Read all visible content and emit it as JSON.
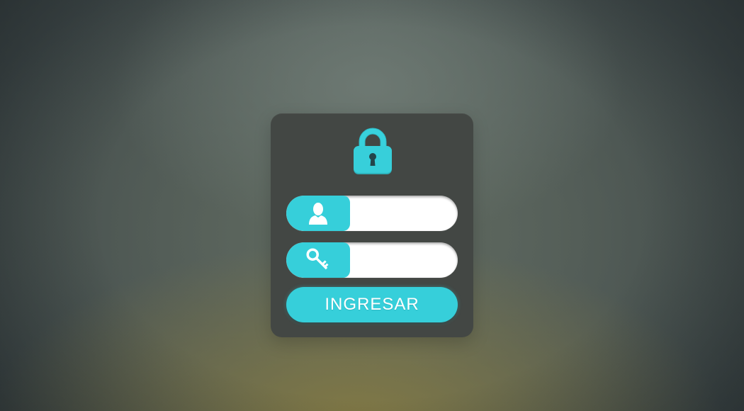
{
  "login": {
    "submit_label": "INGRESAR",
    "username": {
      "value": "",
      "placeholder": "",
      "icon": "user-icon"
    },
    "password": {
      "value": "",
      "placeholder": "",
      "icon": "key-icon"
    },
    "header_icon": "lock-icon"
  },
  "colors": {
    "accent": "#36cfda",
    "card": "#434744",
    "field": "#ffffff"
  }
}
